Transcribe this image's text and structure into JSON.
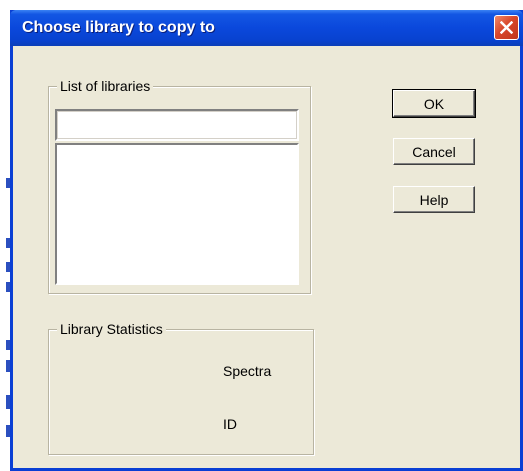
{
  "dialog": {
    "title": "Choose library to copy to",
    "close_icon": "close-icon"
  },
  "libraries_group": {
    "label": "List of libraries",
    "name_field": {
      "value": "",
      "placeholder": ""
    },
    "items": []
  },
  "statistics_group": {
    "label": "Library Statistics",
    "spectra_label": "Spectra",
    "id_label": "ID"
  },
  "buttons": {
    "ok_label": "OK",
    "cancel_label": "Cancel",
    "help_label": "Help"
  },
  "colors": {
    "titlebar": "#0a48dc",
    "close_button": "#d8472a",
    "dialog_face": "#ece9d8"
  }
}
